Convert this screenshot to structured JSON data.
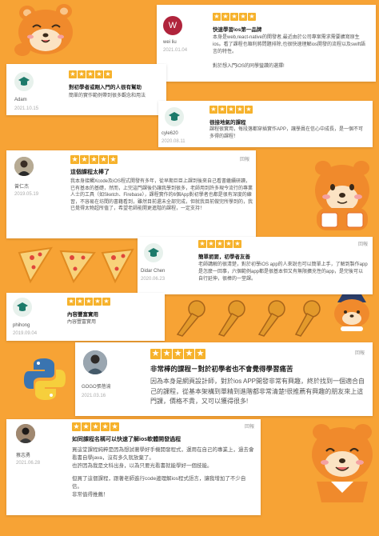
{
  "colors": {
    "background": "#f7a335",
    "star": "#f6b22c",
    "card": "#ffffff",
    "bear": "#f08a2c"
  },
  "report_label": "回報",
  "reviews": [
    {
      "user": "wei liu",
      "avatar_letter": "W",
      "avatar_color": "#b0243c",
      "date": "2021.01.04",
      "title": "快速學習ios第一品牌",
      "body": [
        "本身是web,react-native的開發者,最近由於公司專案需求需要擴寫原生ios。看了課程也順利將問題排除,也很快速理解ios開發的流程以及swift語言的特性。",
        "對於想入門iOS的同學蠻讚的選擇!"
      ]
    },
    {
      "user": "Adam",
      "avatar_icon": "graduation-cap-icon",
      "date": "2021.10.15",
      "title": "對初學者或剛入門的人很有幫助",
      "body": [
        "簡單的實作範例帶到很多觀念和用法"
      ]
    },
    {
      "user": "cyle620",
      "avatar_icon": "graduation-cap-icon",
      "date": "2020.08.11",
      "title": "很接地氣的課程",
      "body": [
        "課程很實用，每段落都穿插實作APP，讓學員在信心中成長，是一個不可多得的課程！"
      ]
    },
    {
      "user": "曾仁杰",
      "avatar_icon": "person-photo-icon",
      "date": "2019.05.19",
      "title": "這個課程太棒了",
      "body": [
        "我本身接觸Xcode及iOS程式開發有多年，從早期巨臣上課到後來自己看書繼續研讀，已有基本的基礎，然而，上完這門課後仍讓我學到很多，老師用到許多現今流行的專業人士的工具（如Sketch、Firebase），課程實作的6個App對初學者也都是很有深度的練習，不容易在坊間的書籍看到，雖然目前還未全部完成，但就我目前做完所學到的，我已覺得太物超所值了，希望老師能開更進階的課程，一定支持！"
      ]
    },
    {
      "user": "Didar Chen",
      "avatar_icon": "graduation-cap-icon",
      "date": "2020.06.23",
      "title": "簡單扼要，初學者友善",
      "body": [
        "老師講解的很清楚，對於初學iOS app的人來說也可以簡單上手，了解到製作app是怎麼一回事，六個範例app都是很基本但又有無限擴充性的app，是完後可以自行延伸，很棒的一堂課。"
      ]
    },
    {
      "user": "phihong",
      "avatar_icon": "graduation-cap-icon",
      "date": "2019.09.04",
      "title": "內容豐富實用",
      "body": [
        "內容豐富實用"
      ]
    },
    {
      "user": "GOGO張蓓渝",
      "avatar_icon": "person-photo-icon",
      "date": "2021.03.16",
      "title": "非常棒的課程－對於初學者也不會覺得學習痛苦",
      "body": [
        "因為本身是網頁設計師，對於ios APP開發非常有興趣，終於找到一個適合自己的課程，從基本架構到單精到進階都非常清楚!很推薦有興趣的朋友來上這門課，價格不貴，又可以獲得很多!"
      ]
    },
    {
      "user": "蔡志勇",
      "avatar_icon": "person-photo-icon",
      "date": "2021.06.28",
      "title": "如同課程名稱可以快速了解ios軟體開發過程",
      "body": [
        "買這堂課程純粹是因為想試著學好手機開發程式，運用在自己的專業上，過去會看書自學java，沒有多久就放棄了。",
        "也許因為我是文科出身，以為只要光看書就能學好一個技能。",
        "但買了這個課程，跟著老師進行code邊理解ios程式語言，讓我增加了不少自信。",
        "非常值得推薦！"
      ]
    }
  ]
}
